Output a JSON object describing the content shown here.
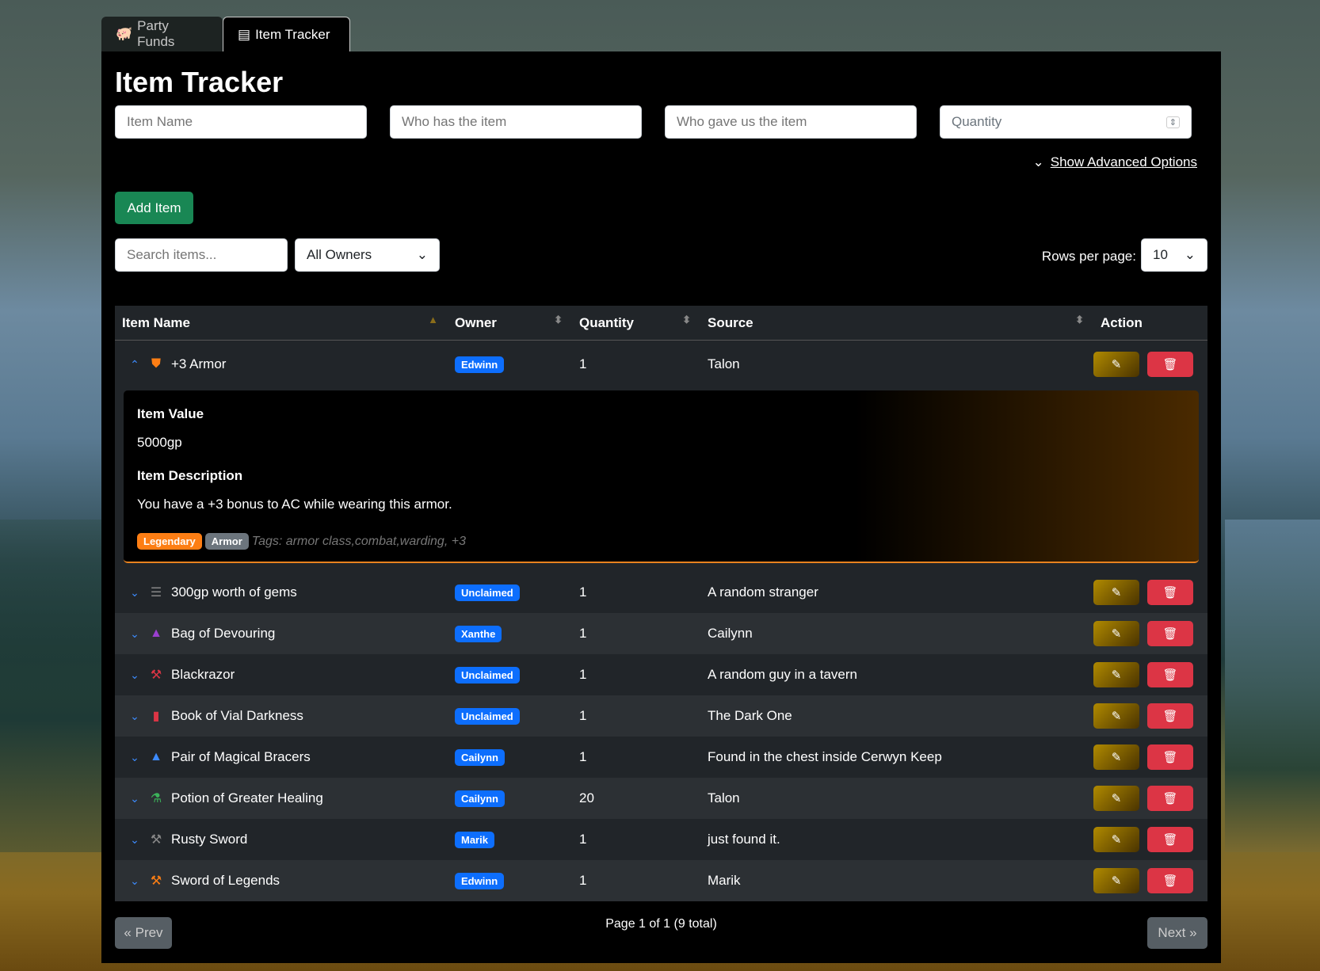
{
  "tabs": [
    {
      "label": "Party Funds",
      "icon": "piggy-bank-icon"
    },
    {
      "label": "Item Tracker",
      "icon": "box-open-icon"
    }
  ],
  "title": "Item Tracker",
  "form": {
    "item_name": "Item Name",
    "holder": "Who has the item",
    "giver": "Who gave us the item",
    "quantity": "Quantity",
    "advanced": "Show Advanced Options",
    "add": "Add Item"
  },
  "filters": {
    "search": "Search items...",
    "owner": "All Owners",
    "rows_label": "Rows per page:",
    "rows": "10"
  },
  "columns": [
    "Item Name",
    "Owner",
    "Quantity",
    "Source",
    "Action"
  ],
  "expanded": {
    "value_label": "Item Value",
    "value": "5000gp",
    "desc_label": "Item Description",
    "desc": "You have a +3 bonus to AC while wearing this armor.",
    "rarity": "Legendary",
    "type": "Armor",
    "tags": "Tags: armor class,combat,warding, +3"
  },
  "items": [
    {
      "name": "+3 Armor",
      "icon": "shield-icon",
      "color": "#fd7e14",
      "glyph": "⛊",
      "owner": "Edwinn",
      "qty": "1",
      "source": "Talon",
      "expanded": true
    },
    {
      "name": "300gp worth of gems",
      "icon": "coins-icon",
      "color": "#888",
      "glyph": "☰",
      "owner": "Unclaimed",
      "qty": "1",
      "source": "A random stranger"
    },
    {
      "name": "Bag of Devouring",
      "icon": "wizard-hat-icon",
      "color": "#9b3fd0",
      "glyph": "▲",
      "owner": "Xanthe",
      "qty": "1",
      "source": "Cailynn"
    },
    {
      "name": "Blackrazor",
      "icon": "gavel-icon",
      "color": "#dc3545",
      "glyph": "⚒",
      "owner": "Unclaimed",
      "qty": "1",
      "source": "A random guy in a tavern"
    },
    {
      "name": "Book of Vial Darkness",
      "icon": "book-icon",
      "color": "#dc3545",
      "glyph": "▮",
      "owner": "Unclaimed",
      "qty": "1",
      "source": "The Dark One"
    },
    {
      "name": "Pair of Magical Bracers",
      "icon": "wizard-hat-icon",
      "color": "#3d8bfd",
      "glyph": "▲",
      "owner": "Cailynn",
      "qty": "1",
      "source": "Found in the chest inside Cerwyn Keep"
    },
    {
      "name": "Potion of Greater Healing",
      "icon": "flask-icon",
      "color": "#3cb35a",
      "glyph": "⚗",
      "owner": "Cailynn",
      "qty": "20",
      "source": "Talon"
    },
    {
      "name": "Rusty Sword",
      "icon": "gavel-icon",
      "color": "#888",
      "glyph": "⚒",
      "owner": "Marik",
      "qty": "1",
      "source": "just found it."
    },
    {
      "name": "Sword of Legends",
      "icon": "gavel-icon",
      "color": "#fd7e14",
      "glyph": "⚒",
      "owner": "Edwinn",
      "qty": "1",
      "source": "Marik"
    }
  ],
  "pagination": {
    "prev": "« Prev",
    "next": "Next »",
    "info": "Page 1 of 1 (9 total)"
  },
  "colors": {
    "accent": "#0d6efd",
    "add": "#198754",
    "delete": "#dc3545",
    "legendary": "#fd7e14"
  }
}
